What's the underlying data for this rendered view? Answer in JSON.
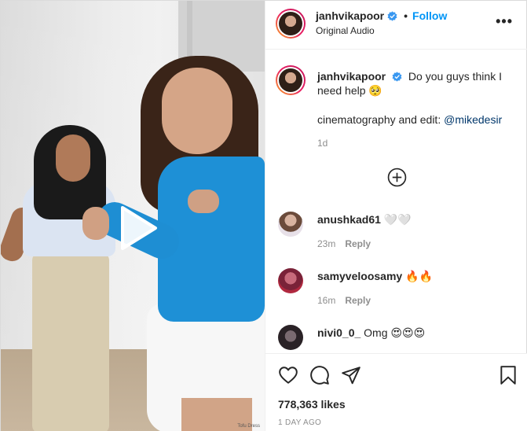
{
  "post": {
    "username": "janhvikapoor",
    "follow_label": "Follow",
    "audio": "Original Audio",
    "more_label": "•••",
    "separator": "•"
  },
  "caption": {
    "username": "janhvikapoor",
    "text": "Do you guys think I need help 🥺",
    "edit_prefix": "cinematography and edit: ",
    "mention": "@mikedesir",
    "time": "1d"
  },
  "media": {
    "watermark": "Tofu Dress"
  },
  "comments": [
    {
      "username": "anushkad61",
      "text": "🤍🤍",
      "time": "23m",
      "reply_label": "Reply"
    },
    {
      "username": "samyveloosamy",
      "text": "🔥🔥",
      "time": "16m",
      "reply_label": "Reply"
    },
    {
      "username": "nivi0_0_",
      "text": "Omg 😍😍😍",
      "time": "",
      "reply_label": ""
    }
  ],
  "stats": {
    "likes": "778,363 likes",
    "date": "1 DAY AGO"
  },
  "icons": {
    "like": "heart-icon",
    "comment": "comment-icon",
    "share": "share-icon",
    "save": "bookmark-icon",
    "play": "play-icon",
    "verified": "verified-badge-icon",
    "add": "add-comments-icon"
  },
  "colors": {
    "accent": "#0095f6",
    "mention": "#00376b",
    "muted": "#8e8e8e"
  }
}
